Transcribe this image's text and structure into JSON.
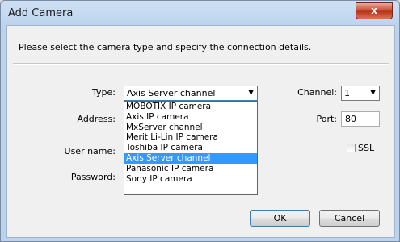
{
  "window": {
    "title": "Add Camera",
    "close_label": "x"
  },
  "instructions": "Please select the camera type and specify the connection details.",
  "form": {
    "type_label": "Type:",
    "type_value": "Axis Server channel",
    "address_label": "Address:",
    "username_label": "User name:",
    "password_label": "Password:",
    "channel_label": "Channel:",
    "channel_value": "1",
    "port_label": "Port:",
    "port_value": "80",
    "ssl_label": "SSL"
  },
  "type_options": [
    "MOBOTIX IP camera",
    "Axis IP camera",
    "MxServer channel",
    "Merit Li-Lin IP camera",
    "Toshiba IP camera",
    "Axis Server channel",
    "Panasonic IP camera",
    "Sony IP camera"
  ],
  "selected_option": "Axis Server channel",
  "buttons": {
    "ok": "OK",
    "cancel": "Cancel"
  },
  "icons": {
    "dropdown_arrow": "chevron-down-icon",
    "close": "close-icon"
  }
}
